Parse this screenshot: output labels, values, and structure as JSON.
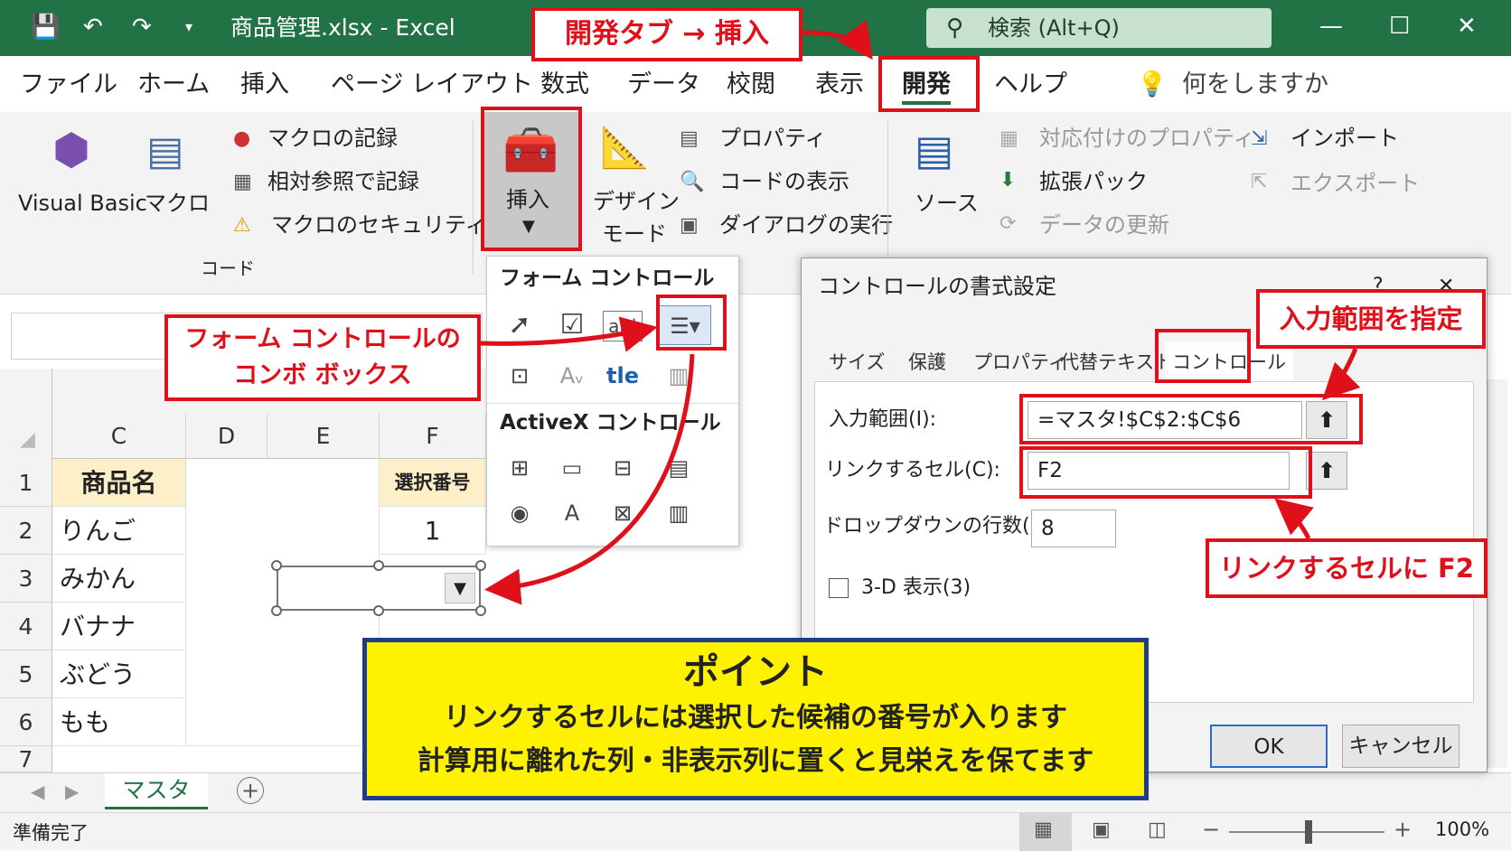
{
  "window": {
    "title": "商品管理.xlsx - Excel",
    "search": "検索 (Alt+Q)"
  },
  "tabs": [
    "ファイル",
    "ホーム",
    "挿入",
    "ページ レイアウト",
    "数式",
    "データ",
    "校閲",
    "表示",
    "開発",
    "ヘルプ"
  ],
  "tell_me": "何をしますか",
  "ribbon": {
    "visual_basic": "Visual Basic",
    "macro": "マクロ",
    "record_macro": "マクロの記録",
    "relative_ref": "相対参照で記録",
    "macro_security": "マクロのセキュリティ",
    "group_code": "コード",
    "insert": "挿入",
    "design_mode_1": "デザイン",
    "design_mode_2": "モード",
    "properties": "プロパティ",
    "view_code": "コードの表示",
    "run_dialog": "ダイアログの実行",
    "source": "ソース",
    "map_properties": "対応付けのプロパティ",
    "expansion_pack": "拡張パック",
    "refresh_data": "データの更新",
    "import": "インポート",
    "export": "エクスポート"
  },
  "dropdown": {
    "form_header": "フォーム コントロール",
    "activex_header": "ActiveX コントロール"
  },
  "grid": {
    "columns": [
      "C",
      "D",
      "E",
      "F"
    ],
    "rows": [
      "1",
      "2",
      "3",
      "4",
      "5",
      "6",
      "7"
    ],
    "c_values": [
      "商品名",
      "りんご",
      "みかん",
      "バナナ",
      "ぶどう",
      "もも"
    ],
    "f1": "選択番号",
    "f2": "1"
  },
  "sheet_tab": "マスタ",
  "status": {
    "ready": "準備完了",
    "zoom": "100%"
  },
  "dialog": {
    "title": "コントロールの書式設定",
    "help": "?",
    "close": "✕",
    "tabs": [
      "サイズ",
      "保護",
      "プロパティ",
      "代替テキスト",
      "コントロール"
    ],
    "input_range_label": "入力範囲(I):",
    "input_range_value": "=マスタ!$C$2:$C$6",
    "link_cell_label": "リンクするセル(C):",
    "link_cell_value": "F2",
    "dropdown_lines_label": "ドロップダウンの行数(D):",
    "dropdown_lines_value": "8",
    "threed_label": "3-D 表示(3)",
    "ok": "OK",
    "cancel": "キャンセル"
  },
  "callouts": {
    "dev_insert": "開発タブ → 挿入",
    "combo_line1": "フォーム コントロールの",
    "combo_line2": "コンボ ボックス",
    "input_range": "入力範囲を指定",
    "link_cell": "リンクするセルに F2"
  },
  "point": {
    "title": "ポイント",
    "line1": "リンクするセルには選択した候補の番号が入ります",
    "line2": "計算用に離れた列・非表示列に置くと見栄えを保てます"
  },
  "colors": {
    "excel_green": "#217346",
    "callout_red": "#e0101a",
    "point_yellow": "#fff200",
    "point_border": "#1f3b8a",
    "header_fill": "#fdf0c8"
  }
}
